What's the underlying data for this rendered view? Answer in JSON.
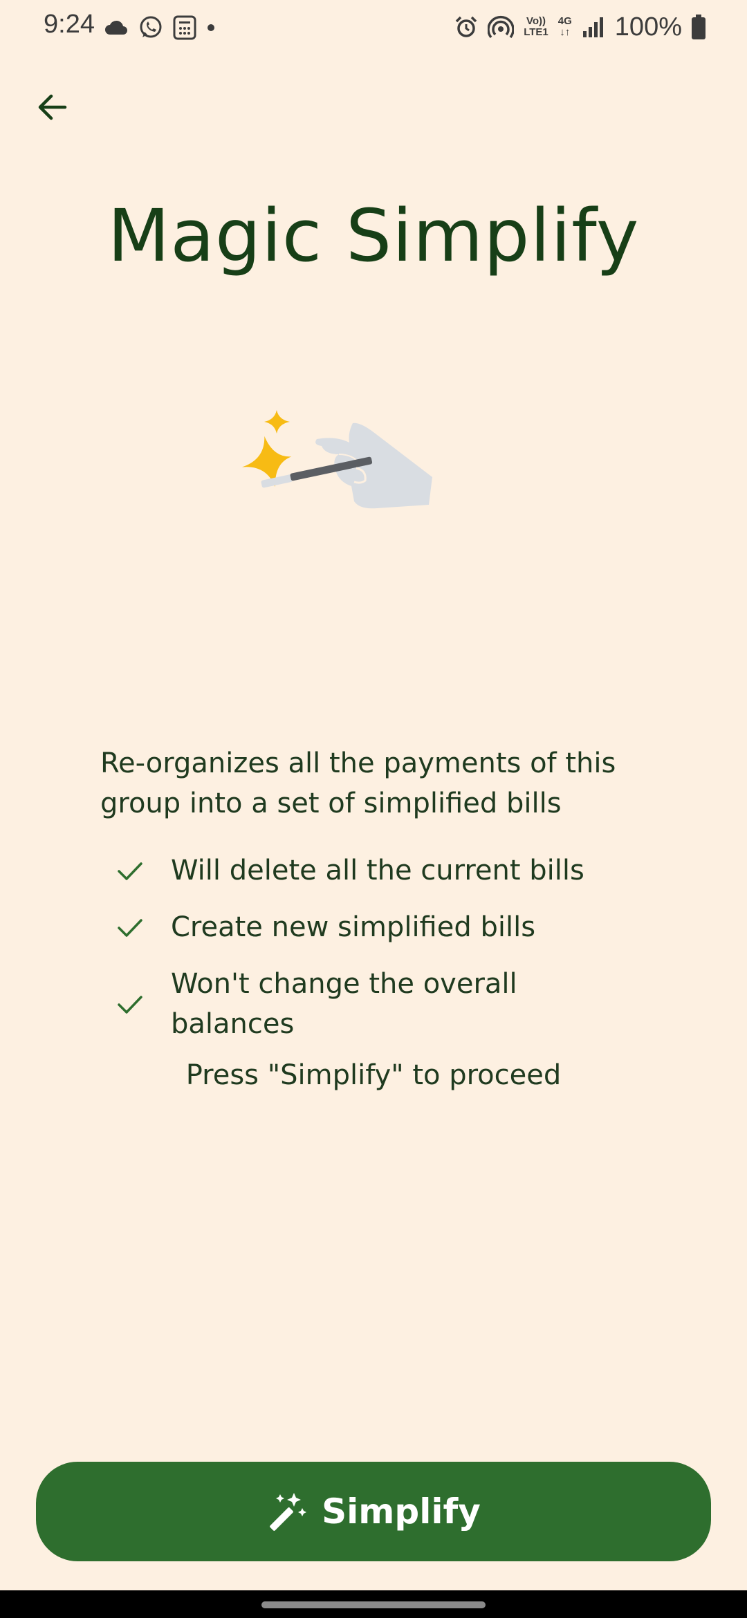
{
  "status_bar": {
    "time": "9:24",
    "battery": "100%",
    "volte_top": "Vo))",
    "volte_bottom": "LTE1",
    "network_top": "4G",
    "network_bottom": "↓↑"
  },
  "page": {
    "title": "Magic Simplify",
    "description": "Re-organizes all the payments of this group into a set of simplified bills",
    "checklist": [
      "Will delete all the current bills",
      "Create new simplified bills",
      "Won't change the overall balances"
    ],
    "proceed_hint": "Press \"Simplify\" to proceed"
  },
  "actions": {
    "simplify_label": "Simplify"
  },
  "colors": {
    "background": "#fdf0e1",
    "accent": "#2e6e2e",
    "title": "#173f17",
    "sparkle": "#f7bb14"
  },
  "icons": {
    "back": "arrow-left-icon",
    "check": "check-icon",
    "wand": "magic-wand-icon"
  }
}
